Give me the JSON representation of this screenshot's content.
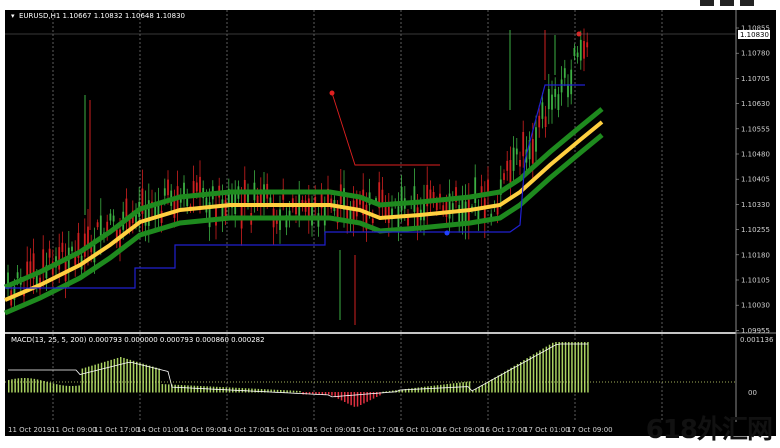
{
  "header": {
    "symbol_info": "EURUSD,H1  1.10667 1.10832 1.10648 1.10830",
    "expand_icon": "triangle-down-icon"
  },
  "macd": {
    "label": "MACD(13, 25, 5, 200) 0.000793 0.000000 0.000793 0.000860 0.000282",
    "axis_top": "0.001136",
    "axis_bottom": "00"
  },
  "price_axis": {
    "labels": [
      "1.10855",
      "1.10780",
      "1.10705",
      "1.10630",
      "1.10555",
      "1.10480",
      "1.10405",
      "1.10330",
      "1.10255",
      "1.10180",
      "1.10105",
      "1.10030",
      "1.09955"
    ],
    "current_price": "1.10830"
  },
  "time_axis": {
    "labels": [
      "11 Oct 2019",
      "11 Oct 09:00",
      "11 Oct 17:00",
      "14 Oct 01:00",
      "14 Oct 09:00",
      "14 Oct 17:00",
      "15 Oct 01:00",
      "15 Oct 09:00",
      "15 Oct 17:00",
      "16 Oct 01:00",
      "16 Oct 09:00",
      "16 Oct 17:00",
      "17 Oct 01:00",
      "17 Oct 09:00"
    ]
  },
  "watermark": "618外汇网",
  "colors": {
    "background": "#000000",
    "bull": "#3cb043",
    "bear": "#d02020",
    "band_outer": "#1e8a1e",
    "band_mid": "#ffd040",
    "stop_line": "#2020d0",
    "signal_dot_red": "#e02020",
    "signal_dot_blue": "#2040ff",
    "macd_hist": "#a8d060",
    "macd_hist_neg": "#e03040"
  }
}
